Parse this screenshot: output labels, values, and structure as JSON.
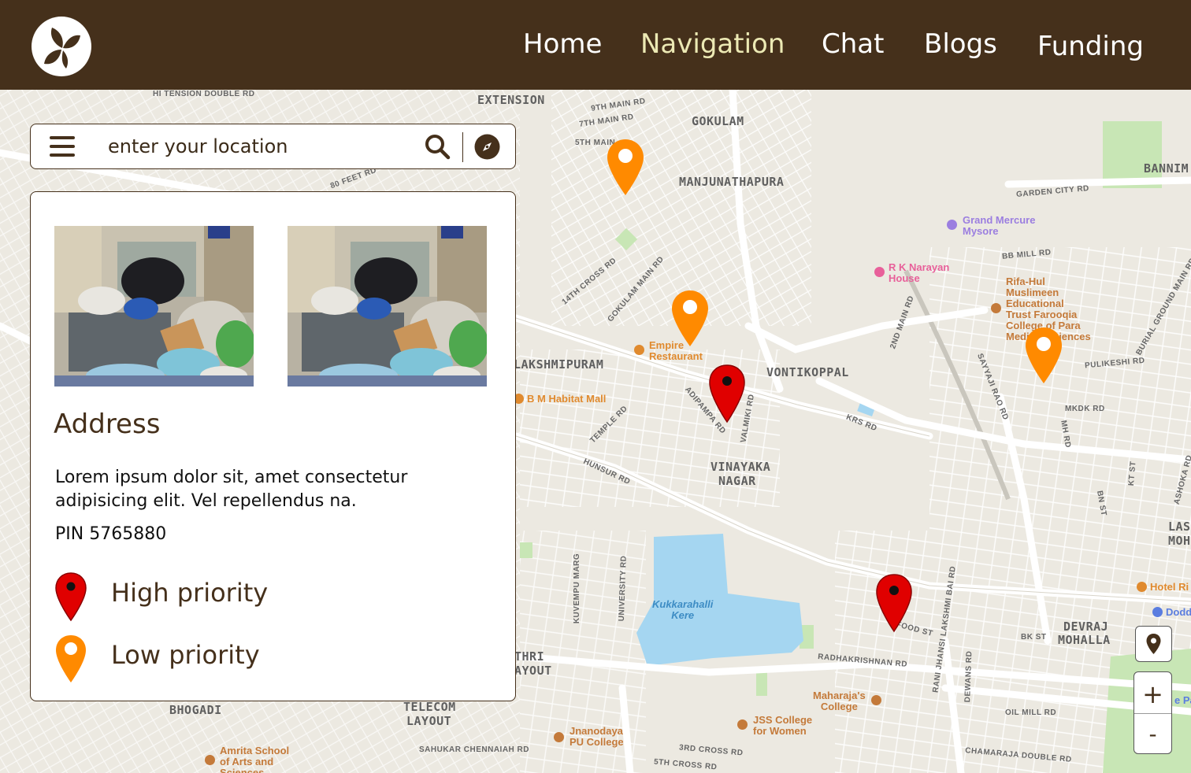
{
  "nav": {
    "links": [
      "Home",
      "Navigation",
      "Chat",
      "Blogs",
      "Funding"
    ],
    "active": "Navigation"
  },
  "search": {
    "placeholder": "enter your location",
    "icons": [
      "menu-icon",
      "search-icon",
      "compass-icon"
    ]
  },
  "panel": {
    "title": "Address",
    "description": "Lorem ipsum dolor sit, amet consectetur adipisicing elit. Vel repellendus na.",
    "pin": "PIN 5765880",
    "legend": [
      {
        "label": "High priority",
        "color": "#e00000"
      },
      {
        "label": "Low priority",
        "color": "#ff8500"
      }
    ]
  },
  "map": {
    "areas": [
      "GOKULAM",
      "MANJUNATHAPURA",
      "LAKSHMIPURAM",
      "VONTIKOPPAL",
      "VINAYAKA",
      "NAGAR",
      "DEVRAJ",
      "MOHALLA",
      "BHOGADI",
      "TELECOM",
      "LAYOUT",
      "EXTENSION",
      "BANNIM",
      "THRI",
      "AYOUT",
      "LAS",
      "MOH"
    ],
    "roads": [
      "HI TENSION DOUBLE RD",
      "9TH MAIN RD",
      "7TH MAIN RD",
      "5TH MAIN",
      "GARDEN CITY RD",
      "BB MILL RD",
      "14TH CROSS RD",
      "GOKULAM MAIN RD",
      "2ND MAIN RD",
      "PULIKESHI RD",
      "MKDK RD",
      "KRS RD",
      "ADIPAMPA RD",
      "VALMIKI RD",
      "TEMPLE RD",
      "HUNSUR RD",
      "SAYYAJI RAO RD",
      "RADHAKRISHNAN RD",
      "RANI JHANSI LAKSHMI BAI RD",
      "FOOD ST",
      "BK ST",
      "OIL MILL RD",
      "CHAMARAJA DOUBLE RD",
      "SAHUKAR CHENNAIAH RD",
      "3RD CROSS RD",
      "5TH CROSS RD",
      "KUVEMPU MARG",
      "UNIVERSITY RD",
      "DEWANS RD",
      "80 FEET RD",
      "BURIAL GROUND MAIN RD",
      "MH RD",
      "BN ST",
      "KT ST",
      "ASHOKA RD"
    ],
    "pois": [
      {
        "name": "Grand Mercure\nMysore",
        "color": "#9b7ee0"
      },
      {
        "name": "R K Narayan\nHouse",
        "color": "#e8609a"
      },
      {
        "name": "Rifa-Hul\nMuslimeen\nEducational\nTrust Farooqia\nCollege of Para\nMedical Sciences",
        "color": "#c47a3a"
      },
      {
        "name": "Empire\nRestaurant",
        "color": "#e08a2e"
      },
      {
        "name": "B M Habitat Mall",
        "color": "#e08a2e"
      },
      {
        "name": "Kukkarahalli\nKere",
        "color": "#3d8cc4"
      },
      {
        "name": "Maharaja's\nCollege",
        "color": "#c47a3a"
      },
      {
        "name": "JSS College\nfor Women",
        "color": "#c47a3a"
      },
      {
        "name": "Jnanodaya\nPU College",
        "color": "#c47a3a"
      },
      {
        "name": "Amrita School\nof Arts and\nSciences",
        "color": "#c47a3a"
      },
      {
        "name": "Hotel Ri",
        "color": "#e08a2e"
      },
      {
        "name": "Dodd",
        "color": "#5a7de0"
      },
      {
        "name": "e Pa",
        "color": "#5a7de0"
      }
    ],
    "markers": [
      {
        "priority": "low"
      },
      {
        "priority": "low"
      },
      {
        "priority": "low"
      },
      {
        "priority": "high"
      },
      {
        "priority": "high"
      }
    ],
    "controls": {
      "zoom_in": "+",
      "zoom_out": "-"
    }
  }
}
